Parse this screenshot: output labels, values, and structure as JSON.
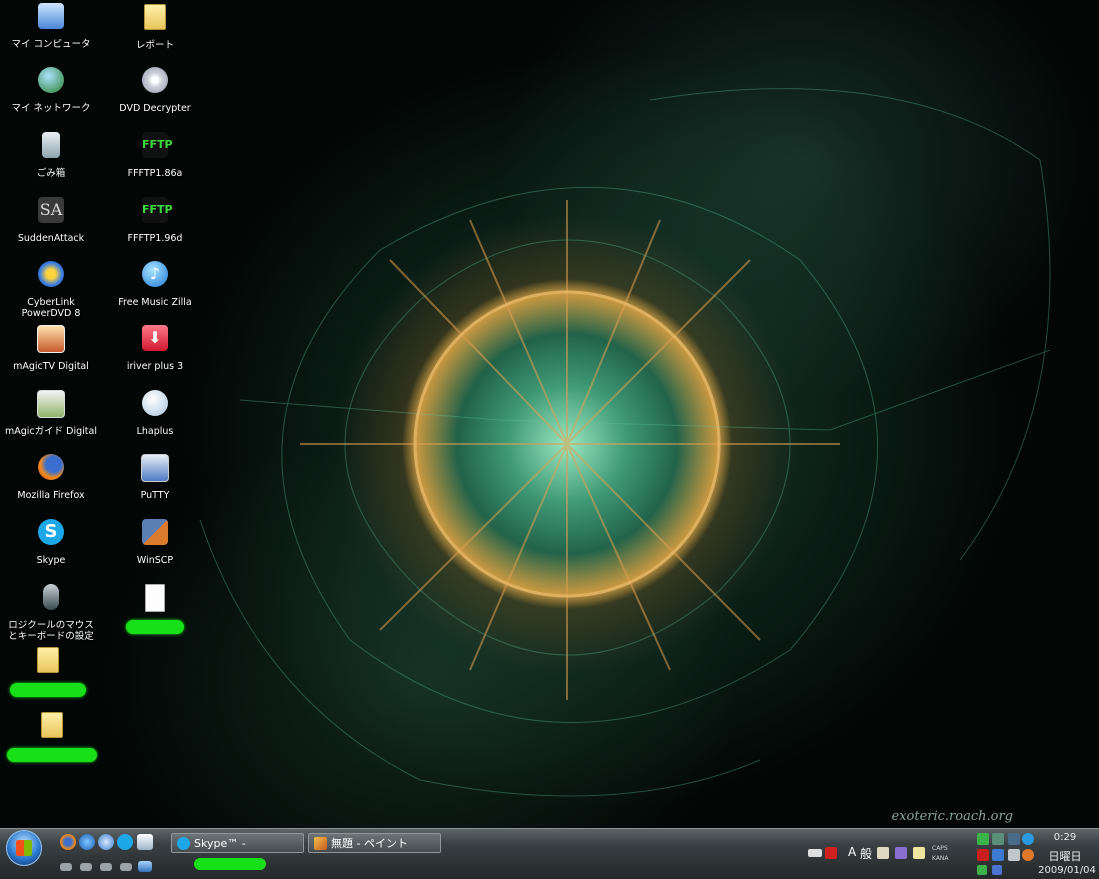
{
  "desktop_icons": [
    {
      "name": "my-computer",
      "label": "マイ コンピュータ",
      "icon": "computer-icon"
    },
    {
      "name": "my-network",
      "label": "マイ ネットワーク",
      "icon": "network-icon"
    },
    {
      "name": "recycle-bin",
      "label": "ごみ箱",
      "icon": "recycle-bin-icon"
    },
    {
      "name": "sudden-attack",
      "label": "SuddenAttack",
      "icon": "game-icon"
    },
    {
      "name": "powerdvd",
      "label": "CyberLink PowerDVD 8",
      "icon": "dvd-player-icon"
    },
    {
      "name": "magictv",
      "label": "mAgicTV Digital",
      "icon": "tv-icon"
    },
    {
      "name": "magic-guide",
      "label": "mAgicガイド Digital",
      "icon": "tv-guide-icon"
    },
    {
      "name": "firefox",
      "label": "Mozilla Firefox",
      "icon": "firefox-icon"
    },
    {
      "name": "skype",
      "label": "Skype",
      "icon": "skype-icon"
    },
    {
      "name": "logicool",
      "label": "ロジクールのマウスとキーボードの設定",
      "icon": "mouse-icon"
    },
    {
      "name": "hidden-folder-1",
      "label": "",
      "icon": "folder-icon"
    },
    {
      "name": "hidden-folder-2",
      "label": "",
      "icon": "folder-icon"
    },
    {
      "name": "report-folder",
      "label": "レポート",
      "icon": "folder-icon"
    },
    {
      "name": "dvd-decrypter",
      "label": "DVD Decrypter",
      "icon": "dvd-icon"
    },
    {
      "name": "ffftp-186a",
      "label": "FFFTP1.86a",
      "icon": "ftp-icon"
    },
    {
      "name": "ffftp-196d",
      "label": "FFFTP1.96d",
      "icon": "ftp-icon"
    },
    {
      "name": "free-music-zilla",
      "label": "Free Music Zilla",
      "icon": "music-icon"
    },
    {
      "name": "iriver-plus",
      "label": "iriver plus 3",
      "icon": "download-icon"
    },
    {
      "name": "lhaplus",
      "label": "Lhaplus",
      "icon": "archive-icon"
    },
    {
      "name": "putty",
      "label": "PuTTY",
      "icon": "terminal-icon"
    },
    {
      "name": "winscp",
      "label": "WinSCP",
      "icon": "transfer-icon"
    },
    {
      "name": "hidden-file",
      "label": "",
      "icon": "document-icon"
    }
  ],
  "wallpaper": {
    "credit": "exoteric.roach.org"
  },
  "taskbar": {
    "buttons": [
      {
        "label": "Skype™ - ",
        "icon": "skype-icon",
        "redacted": true
      },
      {
        "label": "無題 - ペイント",
        "icon": "paint-icon",
        "redacted": false
      }
    ],
    "quick_launch": [
      "firefox-icon",
      "ie-icon",
      "media-player-icon",
      "skype-icon",
      "show-desktop-icon"
    ],
    "ime": {
      "mode": "A",
      "kanji": "般"
    },
    "keys": {
      "caps": "CAPS",
      "kana": "KANA"
    },
    "clock": {
      "time": "0:29",
      "day": "日曜日",
      "date": "2009/01/04"
    }
  },
  "colors": {
    "redaction": "#18e018",
    "taskbar": "#3a4043"
  }
}
